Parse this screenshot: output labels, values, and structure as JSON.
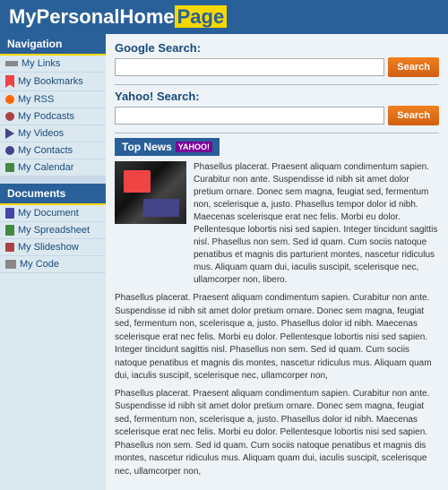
{
  "header": {
    "title_start": "MyPersonalHome",
    "title_highlight": "Page"
  },
  "sidebar": {
    "nav_section": "Navigation",
    "nav_items": [
      {
        "label": "My Links",
        "icon": "links-icon"
      },
      {
        "label": "My Bookmarks",
        "icon": "bookmark-icon"
      },
      {
        "label": "My RSS",
        "icon": "rss-icon"
      },
      {
        "label": "My Podcasts",
        "icon": "podcast-icon"
      },
      {
        "label": "My Videos",
        "icon": "video-icon"
      },
      {
        "label": "My Contacts",
        "icon": "contact-icon"
      },
      {
        "label": "My Calendar",
        "icon": "calendar-icon"
      }
    ],
    "docs_section": "Documents",
    "doc_items": [
      {
        "label": "My Document",
        "icon": "doc-icon"
      },
      {
        "label": "My Spreadsheet",
        "icon": "spreadsheet-icon"
      },
      {
        "label": "My Slideshow",
        "icon": "slideshow-icon"
      },
      {
        "label": "My Code",
        "icon": "code-icon"
      }
    ]
  },
  "main": {
    "google_label": "Google Search:",
    "google_button": "Search",
    "google_placeholder": "",
    "yahoo_label": "Yahoo! Search:",
    "yahoo_button": "Search",
    "yahoo_placeholder": "",
    "top_news_label": "Top News",
    "yahoo_badge": "YAHOO!",
    "news_article_text": "Phasellus placerat. Praesent aliquam condimentum sapien. Curabitur non ante. Suspendisse id nibh sit amet dolor pretium ornare. Donec sem magna, feugiat sed, fermentum non, scelerisque a, justo. Phasellus tempor dolor id nibh. Maecenas scelerisque erat nec felis. Morbi eu dolor. Pellentesque lobortis nisi sed sapien. Integer tincidunt sagittis nisl. Phasellus non sem. Sed id quam. Cum sociis natoque penatibus et magnis dis parturient montes, nascetur ridiculus mus. Aliquam quam dui, iaculis suscipit, scelerisque nec, ullamcorper non, libero.",
    "news_para1": "Phasellus placerat. Praesent aliquam condimentum sapien. Curabitur non ante. Suspendisse id nibh sit amet dolor pretium ornare. Donec sem magna, feugiat sed, fermentum non, scelerisque a, justo. Phasellus dolor id nibh. Maecenas scelerisque erat nec felis. Morbi eu dolor. Pellentesque lobortis nisi sed sapien. Integer tincidunt sagittis nisl. Phasellus non sem. Sed id quam. Cum sociis natoque penatibus et magnis dis montes, nascetur ridiculus mus. Aliquam quam dui, iaculis suscipit, scelerisque nec, ullamcorper non,",
    "news_para2": "Phasellus placerat. Praesent aliquam condimentum sapien. Curabitur non ante. Suspendisse id nibh sit amet dolor pretium ornare. Donec sem magna, feugiat sed, fermentum non, scelerisque a, justo. Phasellus dolor id nibh. Maecenas scelerisque erat nec felis. Morbi eu dolor. Pellentesque lobortis nisi sed sapien. Phasellus non sem. Sed id quam. Cum sociis natoque penatibus et magnis dis montes, nascetur ridiculus mus. Aliquam quam dui, iaculis suscipit, scelerisque nec, ullamcorper non,"
  }
}
